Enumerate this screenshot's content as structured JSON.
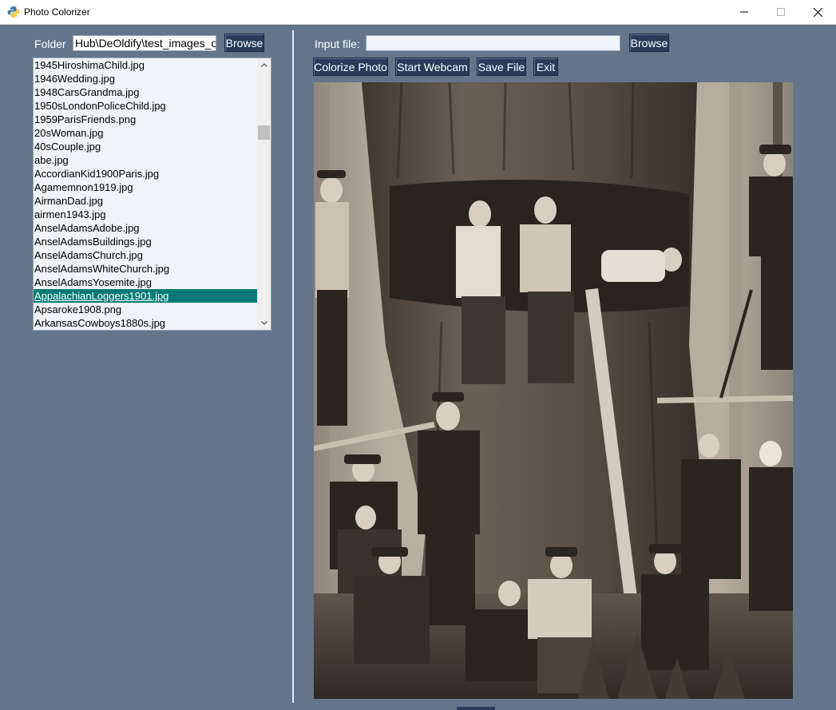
{
  "window": {
    "title": "Photo Colorizer",
    "background": "#64758b",
    "controls": [
      "minimize-icon",
      "maximize-icon",
      "close-icon"
    ]
  },
  "left_panel": {
    "folder_label": "Folder",
    "folder_value": "Hub\\DeOldify\\test_images_old",
    "browse_label": "Browse",
    "files": [
      "1945HiroshimaChild.jpg",
      "1946Wedding.jpg",
      "1948CarsGrandma.jpg",
      "1950sLondonPoliceChild.jpg",
      "1959ParisFriends.png",
      "20sWoman.jpg",
      "40sCouple.jpg",
      "abe.jpg",
      "AccordianKid1900Paris.jpg",
      "Agamemnon1919.jpg",
      "AirmanDad.jpg",
      "airmen1943.jpg",
      "AnselAdamsAdobe.jpg",
      "AnselAdamsBuildings.jpg",
      "AnselAdamsChurch.jpg",
      "AnselAdamsWhiteChurch.jpg",
      "AnselAdamsYosemite.jpg",
      "AppalachianLoggers1901.jpg",
      "Apsaroke1908.png",
      "ArkansasCowboys1880s.jpg"
    ],
    "selected_file": "AppalachianLoggers1901.jpg",
    "selection_color": "#047a76"
  },
  "right_panel": {
    "input_label": "Input file:",
    "input_value": "",
    "browse_label": "Browse",
    "buttons": {
      "colorize": "Colorize Photo",
      "webcam": "Start Webcam",
      "save": "Save File",
      "exit": "Exit"
    },
    "button_color": "#283b5b",
    "image_description_icon": "photo-preview"
  }
}
